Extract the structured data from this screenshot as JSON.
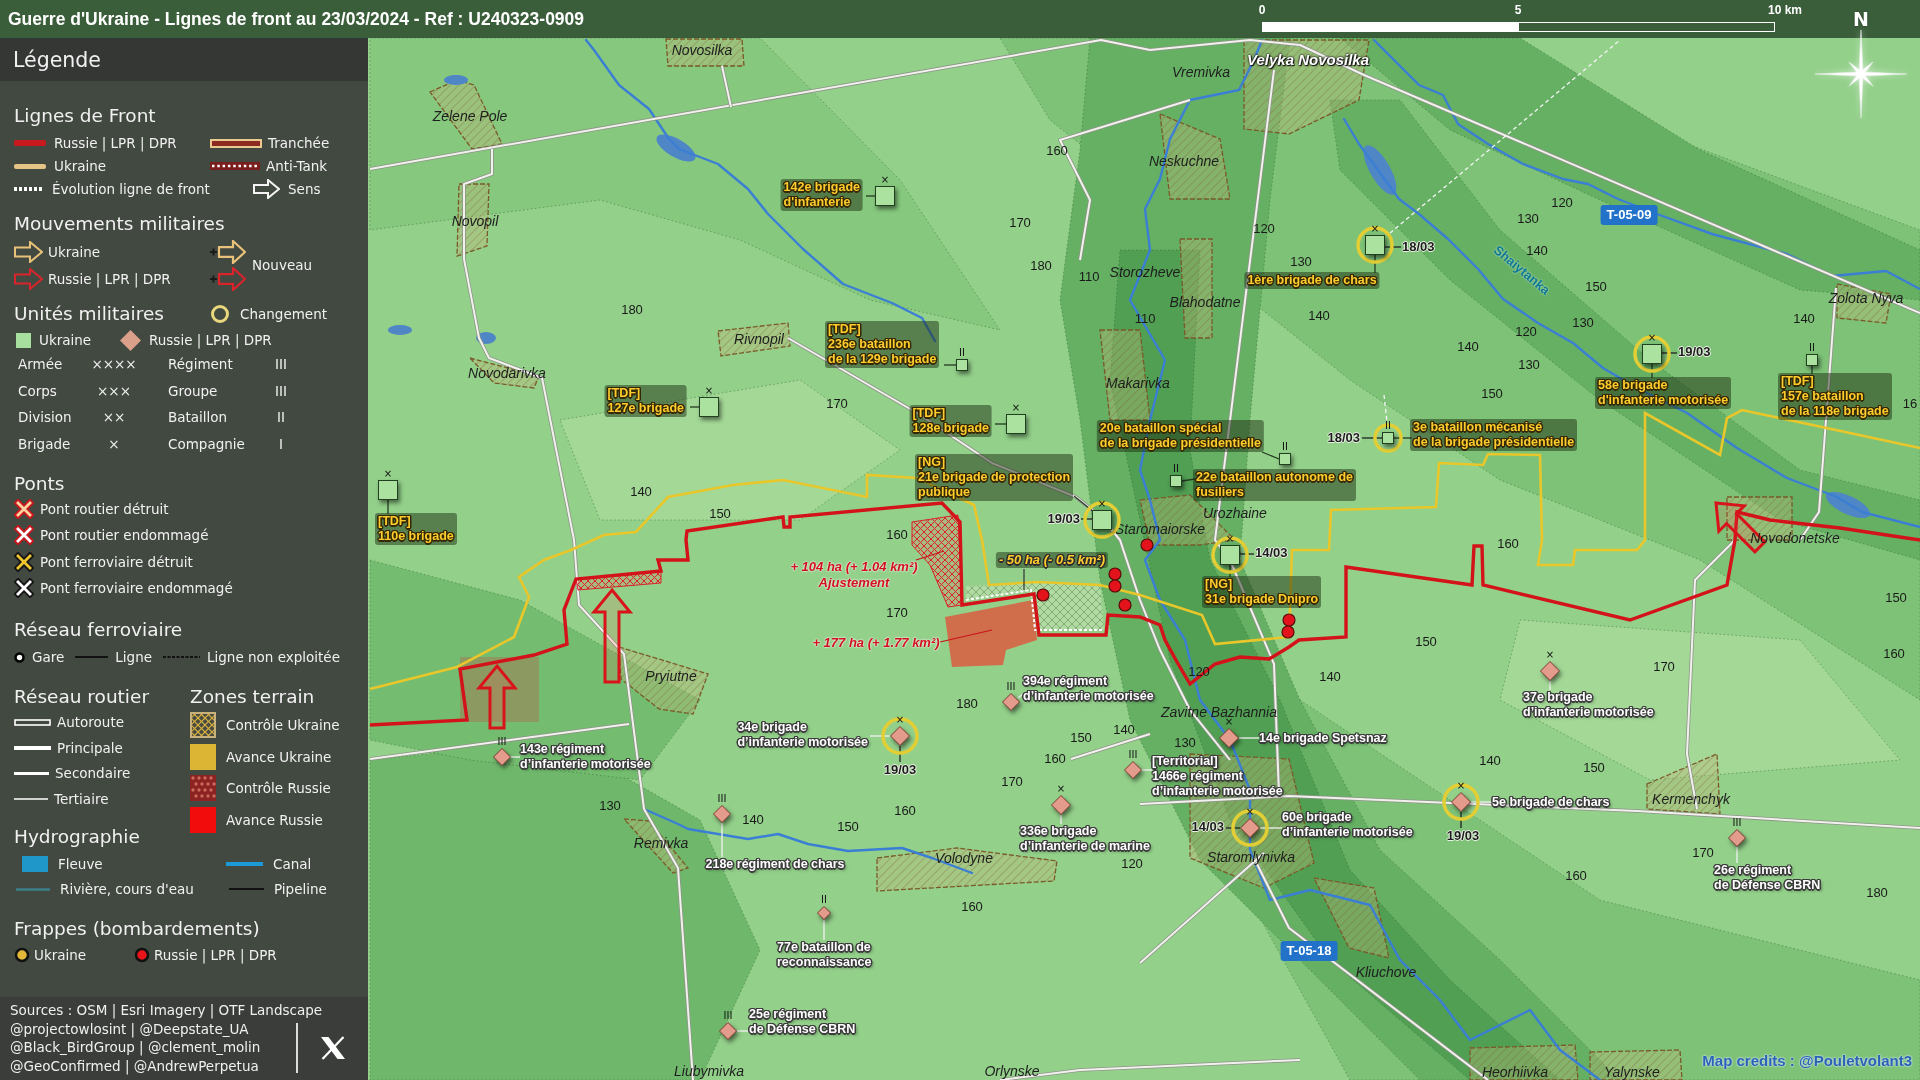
{
  "title_bar": {
    "title": "Guerre d'Ukraine - Lignes de front au 23/03/2024 - Ref : U240323-0909",
    "scale_labels": [
      "0",
      "5",
      "10 km"
    ]
  },
  "compass": {
    "label": "N"
  },
  "legend": {
    "title": "Légende",
    "sections": [
      {
        "kind": "fronts",
        "heading": "Lignes de Front",
        "items": [
          {
            "kind": "front-russia",
            "label": "Russie | LPR | DPR"
          },
          {
            "kind": "trench",
            "label": "Tranchée"
          },
          {
            "kind": "front-ukraine",
            "label": "Ukraine"
          },
          {
            "kind": "antitank",
            "label": "Anti-Tank"
          },
          {
            "kind": "evolution",
            "label": "Évolution ligne de front"
          },
          {
            "kind": "direction",
            "label": "Sens"
          }
        ]
      },
      {
        "kind": "movements",
        "heading": "Mouvements militaires",
        "items": [
          {
            "kind": "arrow-ukraine",
            "label": "Ukraine"
          },
          {
            "kind": "arrow-russia",
            "label": "Russie | LPR | DPR"
          }
        ],
        "new_items": [
          {
            "kind": "arrow-ukraine-new"
          },
          {
            "kind": "arrow-russia-new"
          }
        ],
        "new_label": "Nouveau"
      },
      {
        "kind": "units",
        "heading": "Unités militaires",
        "change_label": "Changement",
        "items": [
          {
            "kind": "unit-ukraine",
            "label": "Ukraine"
          },
          {
            "kind": "unit-russia",
            "label": "Russie | LPR | DPR"
          }
        ],
        "echelons": [
          {
            "name": "Armée",
            "mark": "××××"
          },
          {
            "name": "Corps",
            "mark": "×××"
          },
          {
            "name": "Division",
            "mark": "××"
          },
          {
            "name": "Brigade",
            "mark": "×"
          },
          {
            "name": "Régiment",
            "mark": "III"
          },
          {
            "name": "Groupe",
            "mark": "III"
          },
          {
            "name": "Bataillon",
            "mark": "II"
          },
          {
            "name": "Compagnie",
            "mark": "I"
          }
        ]
      },
      {
        "kind": "bridges",
        "heading": "Ponts",
        "items": [
          {
            "kind": "road-destroyed",
            "label": "Pont routier détruit"
          },
          {
            "kind": "road-damaged",
            "label": "Pont routier endommagé"
          },
          {
            "kind": "rail-destroyed",
            "label": "Pont ferroviaire détruit"
          },
          {
            "kind": "rail-damaged",
            "label": "Pont ferroviaire endommagé"
          }
        ]
      },
      {
        "kind": "rail",
        "heading": "Réseau ferroviaire",
        "items": [
          {
            "kind": "station",
            "label": "Gare"
          },
          {
            "kind": "rail-line",
            "label": "Ligne"
          },
          {
            "kind": "rail-unused",
            "label": "Ligne non exploitée"
          }
        ]
      },
      {
        "kind": "roads",
        "heading": "Réseau routier",
        "items": [
          {
            "kind": "motorway",
            "label": "Autoroute"
          },
          {
            "kind": "road-main",
            "label": "Principale"
          },
          {
            "kind": "road-secondary",
            "label": "Secondaire"
          },
          {
            "kind": "road-tertiary",
            "label": "Tertiaire"
          }
        ]
      },
      {
        "kind": "zones",
        "heading": "Zones terrain",
        "items": [
          {
            "kind": "zone-ukraine-control",
            "label": "Contrôle Ukraine"
          },
          {
            "kind": "zone-ukraine-advance",
            "label": "Avance Ukraine"
          },
          {
            "kind": "zone-russia-control",
            "label": "Contrôle Russie"
          },
          {
            "kind": "zone-russia-advance",
            "label": "Avance Russie"
          }
        ]
      },
      {
        "kind": "hydro",
        "heading": "Hydrographie",
        "items": [
          {
            "kind": "river-major",
            "label": "Fleuve"
          },
          {
            "kind": "canal",
            "label": "Canal"
          },
          {
            "kind": "stream",
            "label": "Rivière, cours d'eau"
          },
          {
            "kind": "pipeline",
            "label": "Pipeline"
          }
        ]
      },
      {
        "kind": "strikes",
        "heading": "Frappes (bombardements)",
        "items": [
          {
            "kind": "strike-ukraine",
            "label": "Ukraine"
          },
          {
            "kind": "strike-russia",
            "label": "Russie | LPR | DPR"
          }
        ]
      }
    ],
    "sources": [
      "Sources : OSM | Esri Imagery | OTF Landscape",
      "@projectowlosint | @Deepstate_UA",
      "@Black_BirdGroup | @clement_molin",
      "@GeoConfirmed | @AndrewPerpetua"
    ]
  },
  "map": {
    "places": [
      {
        "name": "Novosilka",
        "kind": "village"
      },
      {
        "name": "Velyka Novosilka",
        "kind": "town"
      },
      {
        "name": "Vremivka",
        "kind": "village"
      },
      {
        "name": "Zelene Pole",
        "kind": "village"
      },
      {
        "name": "Neskuchne",
        "kind": "village"
      },
      {
        "name": "Novopil",
        "kind": "village"
      },
      {
        "name": "Storozheve",
        "kind": "village"
      },
      {
        "name": "Blahodatne",
        "kind": "village"
      },
      {
        "name": "Zolota Nyva",
        "kind": "village"
      },
      {
        "name": "Rivnopil",
        "kind": "village"
      },
      {
        "name": "Novodarivka",
        "kind": "village"
      },
      {
        "name": "Makarivka",
        "kind": "village"
      },
      {
        "name": "Urozhaine",
        "kind": "village"
      },
      {
        "name": "Staromaiorske",
        "kind": "village"
      },
      {
        "name": "Novodonetske",
        "kind": "village"
      },
      {
        "name": "Pryiutne",
        "kind": "village"
      },
      {
        "name": "Zavitne Bazhannia",
        "kind": "village"
      },
      {
        "name": "Kermenchyk",
        "kind": "village"
      },
      {
        "name": "Remivka",
        "kind": "village"
      },
      {
        "name": "Volodyne",
        "kind": "village"
      },
      {
        "name": "Staromlynivka",
        "kind": "village"
      },
      {
        "name": "Kliuchove",
        "kind": "village"
      },
      {
        "name": "Liubymivka",
        "kind": "village"
      },
      {
        "name": "Orlynske",
        "kind": "village"
      },
      {
        "name": "Heorhiivka",
        "kind": "village"
      },
      {
        "name": "Yalynske",
        "kind": "village"
      }
    ],
    "elevations": [
      "160",
      "120",
      "170",
      "130",
      "120",
      "140",
      "180",
      "130",
      "110",
      "150",
      "180",
      "110",
      "140",
      "130",
      "140",
      "120",
      "140",
      "130",
      "150",
      "170",
      "16",
      "140",
      "150",
      "160",
      "160",
      "150",
      "170",
      "150",
      "160",
      "120",
      "170",
      "140",
      "180",
      "140",
      "150",
      "130",
      "160",
      "140",
      "150",
      "170",
      "130",
      "160",
      "140",
      "150",
      "170",
      "120",
      "160",
      "180",
      "160"
    ],
    "road_numbers": [
      "T-05-09",
      "T-05-18"
    ],
    "river_names": [
      "Shaiytanka"
    ],
    "units": [
      {
        "kind": "ukraine",
        "echelon": "×",
        "label": [
          "142e brigade",
          "d'infanterie"
        ],
        "changed": false
      },
      {
        "kind": "ukraine",
        "echelon": "×",
        "label": [
          "1ère brigade de chars"
        ],
        "changed": true,
        "date": "18/03"
      },
      {
        "kind": "ukraine",
        "echelon": "II",
        "label": [
          "[TDF]",
          "236e bataillon",
          "de la 129e brigade"
        ],
        "changed": false
      },
      {
        "kind": "ukraine",
        "echelon": "×",
        "label": [
          "[TDF]",
          "127e brigade"
        ],
        "changed": false
      },
      {
        "kind": "ukraine",
        "echelon": "×",
        "label": [
          "58e brigade",
          "d'infanterie motorisée"
        ],
        "changed": true,
        "date": "19/03"
      },
      {
        "kind": "ukraine",
        "echelon": "II",
        "label": [
          "[TDF]",
          "157e bataillon",
          "de la 118e brigade"
        ],
        "changed": false
      },
      {
        "kind": "ukraine",
        "echelon": "×",
        "label": [
          "[TDF]",
          "128e brigade"
        ],
        "changed": false
      },
      {
        "kind": "ukraine",
        "echelon": "II",
        "label": [
          "20e bataillon spécial",
          "de la brigade présidentielle"
        ],
        "changed": false
      },
      {
        "kind": "ukraine",
        "echelon": "II",
        "label": [
          "3e bataillon mécanisé",
          "de la brigade présidentielle"
        ],
        "changed": true,
        "date": "18/03"
      },
      {
        "kind": "ukraine",
        "echelon": "×",
        "label": [
          "[TDF]",
          "110e brigade"
        ],
        "changed": false
      },
      {
        "kind": "ukraine",
        "echelon": "×",
        "label": [
          "[NG]",
          "21e brigade de protection",
          "publique"
        ],
        "changed": true,
        "date": "19/03"
      },
      {
        "kind": "ukraine",
        "echelon": "II",
        "label": [
          "22e bataillon autonome de",
          "fusiliers"
        ],
        "changed": false
      },
      {
        "kind": "ukraine",
        "echelon": "×",
        "label": [
          "[NG]",
          "31e brigade Dnipro"
        ],
        "changed": true,
        "date": "14/03"
      },
      {
        "kind": "russia",
        "echelon": "III",
        "label": [
          "394e régiment",
          "d’infanterie motorisée"
        ],
        "changed": false
      },
      {
        "kind": "russia",
        "echelon": "×",
        "label": [
          "37e brigade",
          "d’infanterie motorisée"
        ],
        "changed": false
      },
      {
        "kind": "russia",
        "echelon": "III",
        "label": [
          "143e régiment",
          "d’infanterie motorisée"
        ],
        "changed": false
      },
      {
        "kind": "russia",
        "echelon": "×",
        "label": [
          "34e brigade",
          "d’infanterie motorisée"
        ],
        "changed": true,
        "date": "19/03"
      },
      {
        "kind": "russia",
        "echelon": "×",
        "label": [
          "14e brigade Spetsnaz"
        ],
        "changed": false
      },
      {
        "kind": "russia",
        "echelon": "III",
        "label": [
          "[Territorial]",
          "1466e régiment",
          "d’infanterie motorisée"
        ],
        "changed": false
      },
      {
        "kind": "russia",
        "echelon": "III",
        "label": [
          "218e régiment de chars"
        ],
        "changed": false
      },
      {
        "kind": "russia",
        "echelon": "×",
        "label": [
          "336e brigade",
          "d’infanterie de marine"
        ],
        "changed": false
      },
      {
        "kind": "russia",
        "echelon": "×",
        "label": [
          "60e brigade",
          "d’infanterie motorisée"
        ],
        "changed": true,
        "date": "14/03"
      },
      {
        "kind": "russia",
        "echelon": "×",
        "label": [
          "5e brigade de chars"
        ],
        "changed": true,
        "date": "19/03"
      },
      {
        "kind": "russia",
        "echelon": "III",
        "label": [
          "26e régiment",
          "de Défense CBRN"
        ],
        "changed": false
      },
      {
        "kind": "russia",
        "echelon": "II",
        "label": [
          "77e bataillon de",
          "reconnaissance"
        ],
        "changed": false
      },
      {
        "kind": "russia",
        "echelon": "III",
        "label": [
          "25e régiment",
          "de Défense CBRN"
        ],
        "changed": false
      }
    ],
    "area_changes": [
      {
        "kind": "russia",
        "lines": [
          "+ 104 ha (+ 1.04 km²)",
          "Ajustement"
        ]
      },
      {
        "kind": "ukraine",
        "lines": [
          "- 50 ha (- 0.5 km²)"
        ]
      },
      {
        "kind": "russia",
        "lines": [
          "+ 177 ha (+ 1.77 km²)"
        ]
      }
    ],
    "strikes": [
      {
        "kind": "russia"
      },
      {
        "kind": "russia"
      },
      {
        "kind": "russia"
      },
      {
        "kind": "russia"
      },
      {
        "kind": "russia"
      },
      {
        "kind": "russia"
      },
      {
        "kind": "russia"
      }
    ],
    "credit": "Map credits : @Pouletvolant3"
  }
}
